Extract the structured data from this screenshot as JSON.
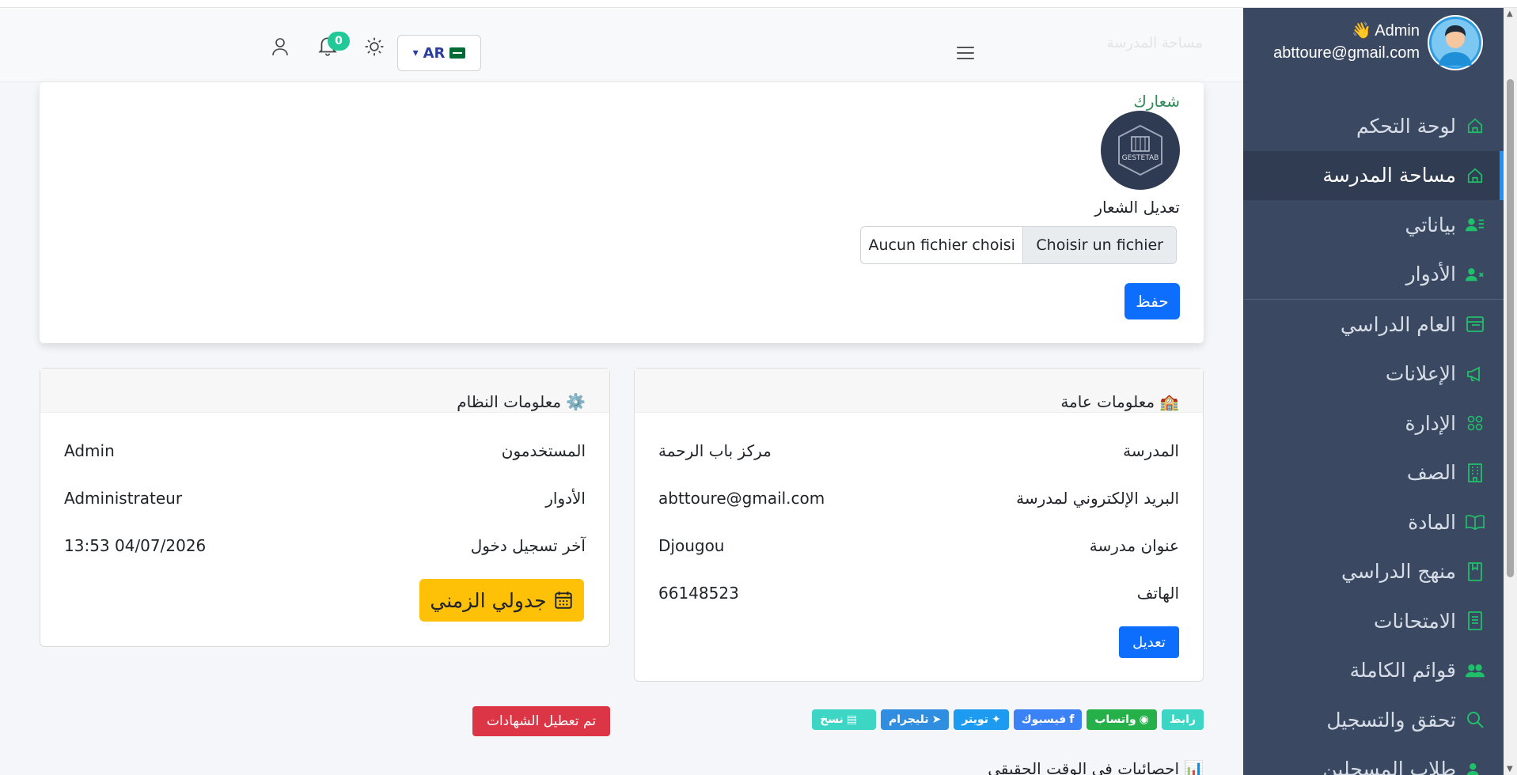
{
  "header": {
    "faded_title": "مساحة المدرسة",
    "lang": {
      "code": "AR",
      "arrow": "▾"
    },
    "notifications_count": "0"
  },
  "sidebar": {
    "user": {
      "name": "Admin",
      "wave": "👋",
      "email": "abttoure@gmail.com"
    },
    "items": [
      {
        "label": "لوحة التحكم",
        "icon": "home-icon"
      },
      {
        "label": "مساحة المدرسة",
        "icon": "home-icon",
        "active": true
      },
      {
        "label": "بياناتي",
        "icon": "user-list-icon"
      },
      {
        "label": "الأدوار",
        "icon": "user-x-icon"
      },
      {
        "label": "العام الدراسي",
        "icon": "calendar-card-icon"
      },
      {
        "label": "الإعلانات",
        "icon": "megaphone-icon"
      },
      {
        "label": "الإدارة",
        "icon": "users-icon"
      },
      {
        "label": "الصف",
        "icon": "building-icon"
      },
      {
        "label": "المادة",
        "icon": "book-open-icon"
      },
      {
        "label": "منهج الدراسي",
        "icon": "book-icon"
      },
      {
        "label": "الامتحانات",
        "icon": "document-icon"
      },
      {
        "label": "قوائم الكاملة",
        "icon": "group-icon"
      },
      {
        "label": "تحقق والتسجيل",
        "icon": "search-icon"
      },
      {
        "label": "طلاب المسجلين",
        "icon": "user-check-icon"
      }
    ]
  },
  "logo_card": {
    "label": "شعارك",
    "logo_text": "GESTETAB",
    "edit_label": "تعديل الشعار",
    "file_choose": "Choisir un fichier",
    "file_none": "Aucun fichier choisi",
    "save_label": "حفظ"
  },
  "general_info": {
    "emoji": "🏫",
    "title": "معلومات عامة",
    "rows": [
      {
        "key": "المدرسة",
        "value": "مركز باب الرحمة"
      },
      {
        "key": "البريد الإلكتروني لمدرسة",
        "value": "abttoure@gmail.com"
      },
      {
        "key": "عنوان مدرسة",
        "value": "Djougou"
      },
      {
        "key": "الهاتف",
        "value": "66148523"
      }
    ],
    "edit_label": "تعديل"
  },
  "system_info": {
    "emoji": "⚙️",
    "title": "معلومات النظام",
    "rows": [
      {
        "key": "المستخدمون",
        "value": "Admin"
      },
      {
        "key": "الأدوار",
        "value": "Administrateur"
      },
      {
        "key": "آخر تسجيل دخول",
        "value": "13:53 04/07/2026"
      }
    ],
    "schedule_label": "جدولي الزمني"
  },
  "share": {
    "buttons": [
      {
        "label": "رابط",
        "color": "#3dd5c3"
      },
      {
        "label": "واتساب",
        "color": "#25b04a"
      },
      {
        "label": "فيسبوك",
        "color": "#3b82f6"
      },
      {
        "label": "تويتر",
        "color": "#1d9bf0"
      },
      {
        "label": "تليجرام",
        "color": "#2f8ee0"
      },
      {
        "label": "نسخ",
        "color": "#3dd5c3"
      }
    ]
  },
  "certificates_label": "تم تعطيل الشهادات",
  "stats_title": "احصائيات في الوقت الحقيقي",
  "stats_emoji": "📊"
}
